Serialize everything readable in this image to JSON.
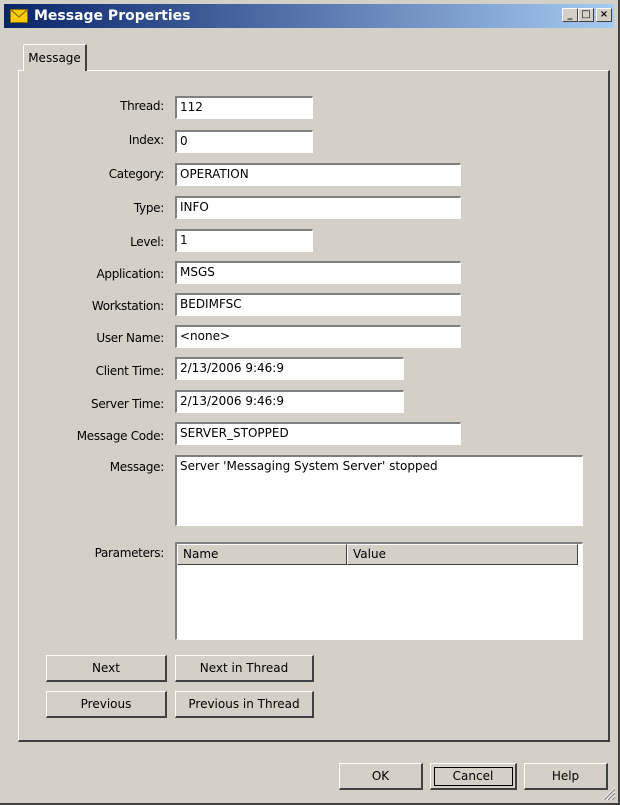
{
  "window": {
    "title": "Message Properties",
    "minimize_label": "_",
    "maximize_label": "□",
    "close_label": "×"
  },
  "tabs": [
    {
      "label": "Message",
      "active": true
    }
  ],
  "fields": {
    "thread": {
      "label": "Thread:",
      "value": "112"
    },
    "index": {
      "label": "Index:",
      "value": "0"
    },
    "category": {
      "label": "Category:",
      "value": "OPERATION"
    },
    "type": {
      "label": "Type:",
      "value": "INFO"
    },
    "level": {
      "label": "Level:",
      "value": "1"
    },
    "application": {
      "label": "Application:",
      "value": "MSGS"
    },
    "workstation": {
      "label": "Workstation:",
      "value": "BEDIMFSC"
    },
    "user_name": {
      "label": "User Name:",
      "value": "<none>"
    },
    "client_time": {
      "label": "Client Time:",
      "value": "2/13/2006 9:46:9"
    },
    "server_time": {
      "label": "Server Time:",
      "value": "2/13/2006 9:46:9"
    },
    "message_code": {
      "label": "Message Code:",
      "value": "SERVER_STOPPED"
    },
    "message": {
      "label": "Message:",
      "value": "Server 'Messaging System Server' stopped"
    }
  },
  "parameters": {
    "label": "Parameters:",
    "columns": [
      "Name",
      "Value"
    ],
    "rows": []
  },
  "nav_buttons": {
    "next": "Next",
    "next_in_thread": "Next in Thread",
    "previous": "Previous",
    "previous_in_thread": "Previous in Thread"
  },
  "dialog_buttons": {
    "ok": "OK",
    "cancel": "Cancel",
    "help": "Help"
  },
  "colors": {
    "titlebar_start": "#0a246a",
    "titlebar_end": "#a6caf0",
    "face": "#d4d0c8"
  }
}
